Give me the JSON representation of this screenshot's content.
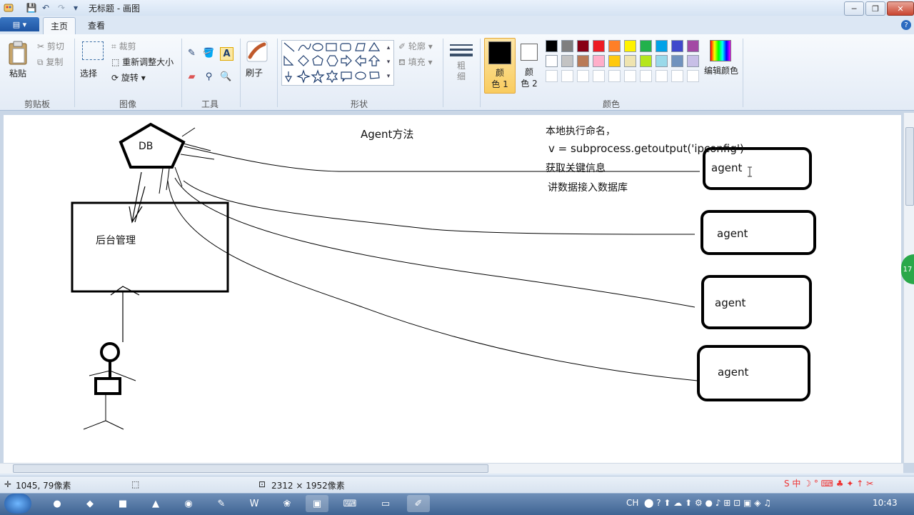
{
  "window": {
    "title": "无标题 - 画图",
    "controls": {
      "minimize": "─",
      "maximize": "❐",
      "close": "✕"
    },
    "help": "?"
  },
  "quick_access": {
    "save_icon": "💾",
    "undo_icon": "↶",
    "redo_icon": "↷",
    "dropdown_icon": "▾"
  },
  "tabs": {
    "file": "▤ ▾",
    "home": "主页",
    "view": "查看"
  },
  "ribbon": {
    "clipboard": {
      "label": "剪贴板",
      "paste": "粘贴",
      "cut": "剪切",
      "copy": "复制"
    },
    "image": {
      "label": "图像",
      "select": "选择",
      "crop": "裁剪",
      "resize": "重新调整大小",
      "rotate": "旋转"
    },
    "tools": {
      "label": "工具"
    },
    "brushes": {
      "label": "刷子"
    },
    "shapes": {
      "label": "形状",
      "outline": "轮廓",
      "fill": "填充"
    },
    "size": {
      "label": "粗细"
    },
    "colors": {
      "label": "颜色",
      "color1_line1": "颜",
      "color1_line2": "色 1",
      "color2_line1": "颜",
      "color2_line2": "色 2",
      "edit": "编辑颜色",
      "color1": "#000000",
      "color2": "#ffffff",
      "palette_row1": [
        "#000000",
        "#7f7f7f",
        "#880015",
        "#ed1c24",
        "#ff7f27",
        "#fff200",
        "#22b14c",
        "#00a2e8",
        "#3f48cc",
        "#a349a4"
      ],
      "palette_row2": [
        "#ffffff",
        "#c3c3c3",
        "#b97a57",
        "#ffaec9",
        "#ffc90e",
        "#efe4b0",
        "#b5e61d",
        "#99d9ea",
        "#7092be",
        "#c8bfe7"
      ]
    }
  },
  "canvas": {
    "db_label": "DB",
    "title": "Agent方法",
    "note_lines": [
      "本地执行命名，",
      "v = subprocess.getoutput('ipconfig')",
      "获取关键信息",
      "讲数据接入数据库"
    ],
    "backend_label": "后台管理",
    "agents": [
      "agent",
      "agent",
      "agent",
      "agent"
    ]
  },
  "statusbar": {
    "cursor_pos": "1045, 79像素",
    "canvas_size": "2312 × 1952像素"
  },
  "badge": "17",
  "taskbar": {
    "clock": "10:43",
    "lang": "CH"
  }
}
